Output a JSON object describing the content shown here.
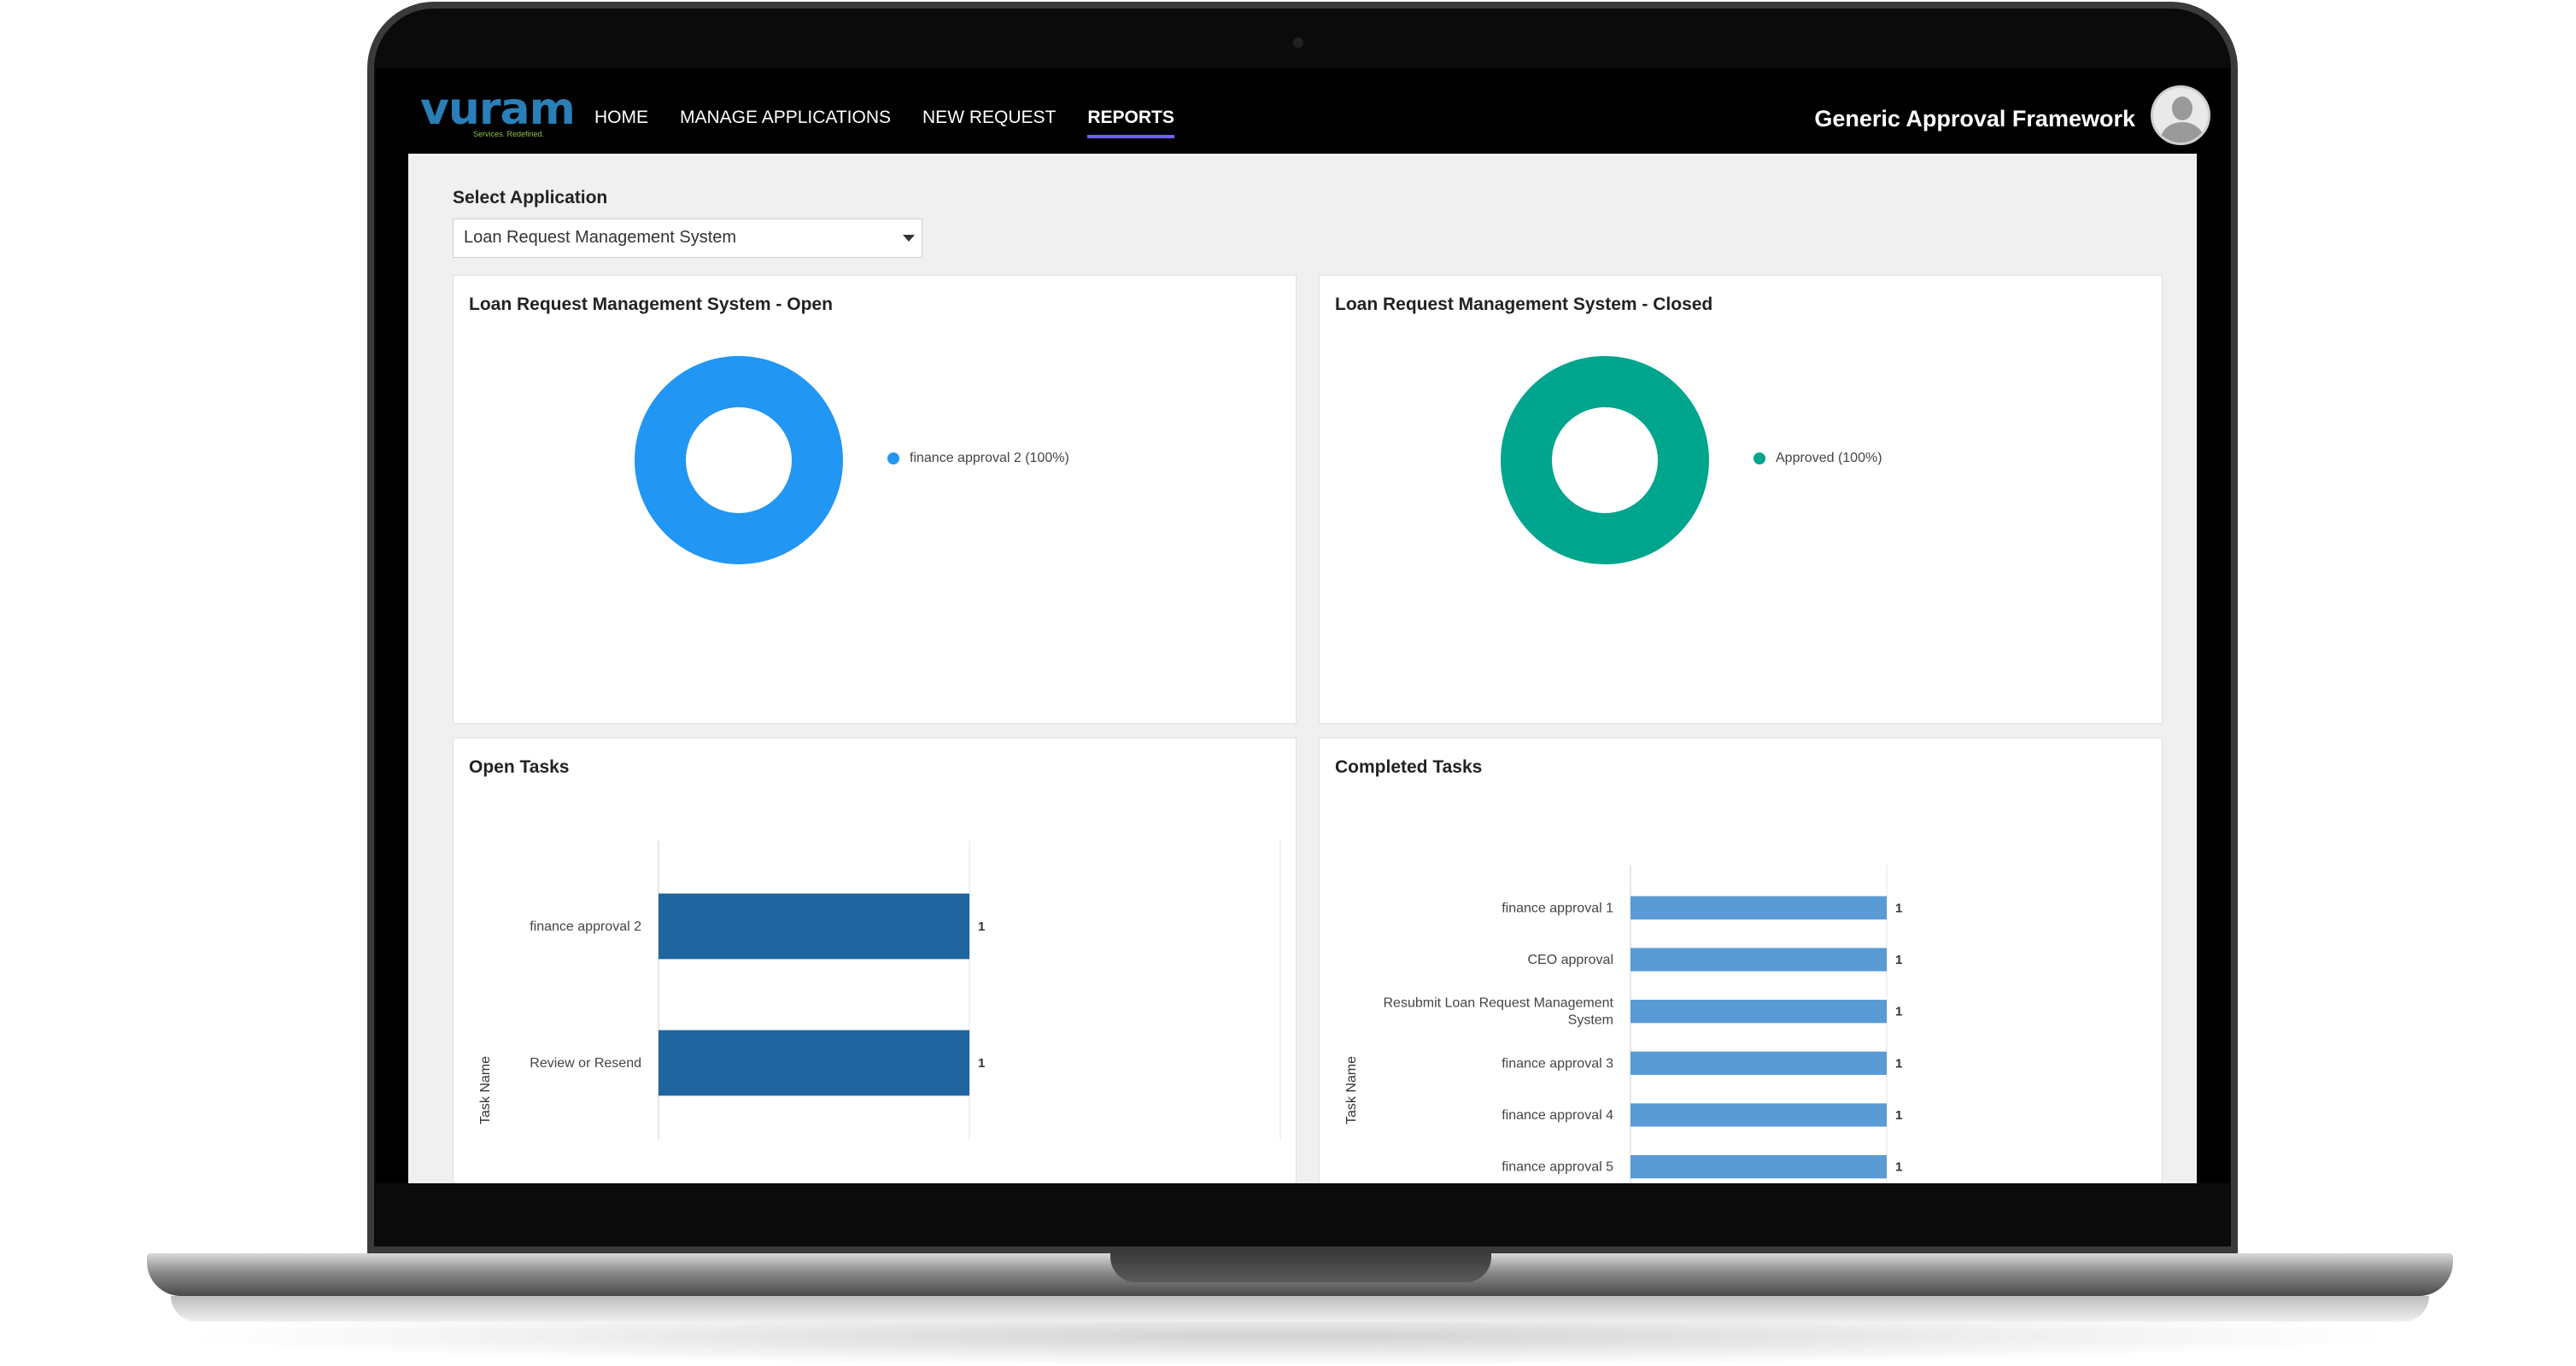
{
  "nav": {
    "logo_text": "vuram",
    "logo_tagline": "Services. Redefined.",
    "links": [
      {
        "label": "HOME"
      },
      {
        "label": "MANAGE APPLICATIONS"
      },
      {
        "label": "NEW REQUEST"
      },
      {
        "label": "REPORTS",
        "active": true
      }
    ],
    "app_title": "Generic Approval Framework"
  },
  "filter": {
    "label": "Select Application",
    "selected": "Loan Request Management System"
  },
  "colors": {
    "open_donut": "#2196f3",
    "closed_donut": "#00a58e",
    "open_bar": "#1f65a0",
    "completed_bar": "#5b9bd5",
    "nav_active_underline": "#6c63ff"
  },
  "cards": {
    "open_title": "Loan Request Management System - Open",
    "closed_title": "Loan Request Management System - Closed",
    "open_tasks_title": "Open Tasks",
    "completed_tasks_title": "Completed Tasks"
  },
  "chart_data": [
    {
      "type": "pie",
      "title": "Loan Request Management System - Open",
      "labels": [
        "finance approval 2 (100%)"
      ],
      "values": [
        100
      ],
      "donut": true,
      "legend": "right"
    },
    {
      "type": "pie",
      "title": "Loan Request Management System - Closed",
      "labels": [
        "Approved (100%)"
      ],
      "values": [
        100
      ],
      "donut": true,
      "legend": "right"
    },
    {
      "type": "bar",
      "orientation": "horizontal",
      "title": "Open Tasks",
      "ylabel": "Task Name",
      "categories": [
        "finance approval 2",
        "Review or Resend"
      ],
      "values": [
        1,
        1
      ],
      "xlim": [
        0,
        2
      ],
      "data_labels": true
    },
    {
      "type": "bar",
      "orientation": "horizontal",
      "title": "Completed Tasks",
      "ylabel": "Task Name",
      "categories": [
        "finance approval 1",
        "CEO approval",
        "Resubmit Loan Request Management System",
        "finance approval 3",
        "finance approval 4",
        "finance approval 5"
      ],
      "values": [
        1,
        1,
        1,
        1,
        1,
        1
      ],
      "xlim": [
        0,
        1
      ],
      "data_labels": true
    }
  ]
}
